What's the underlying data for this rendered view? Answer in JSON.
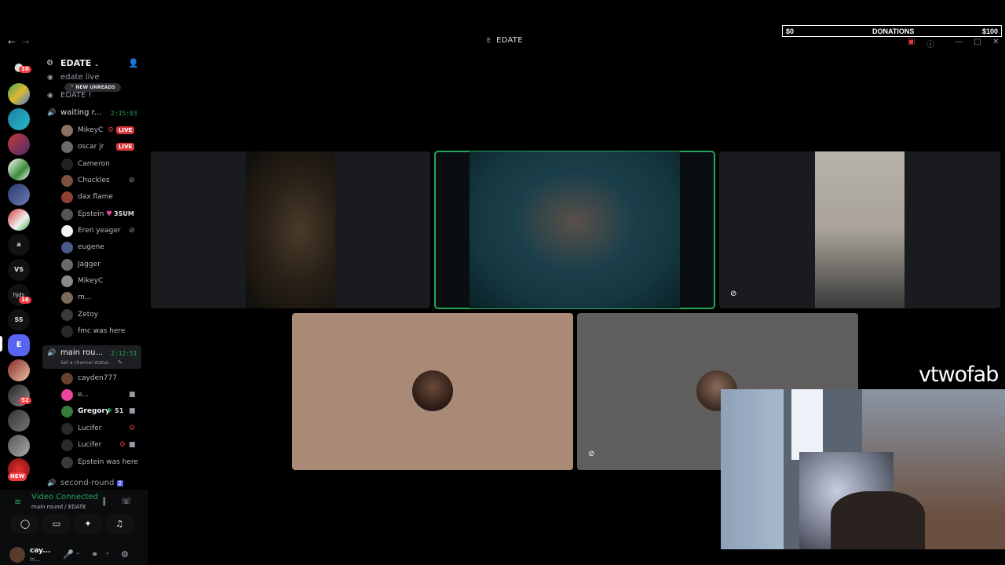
{
  "window": {
    "title": "EDATE",
    "title_icon": "E"
  },
  "donations": {
    "left": "$0",
    "label": "DONATIONS",
    "right": "$100"
  },
  "rail": {
    "home_badge": "10",
    "text_servers": [
      "a",
      "VS",
      "SS"
    ],
    "badge_1": "16",
    "badge_2": "52",
    "active_letter": "E",
    "new_label": "NEW"
  },
  "guild": {
    "name": "EDATE"
  },
  "new_unreads": "NEW UNREADS",
  "channels": {
    "c1": "edate live",
    "c2": "EDATE !",
    "waiting": {
      "name": "waiting r...",
      "time": "2:15:03"
    },
    "main": {
      "name": "main rou...",
      "time": "2:12:51",
      "status": "Set a channel status"
    },
    "second": {
      "name": "second-round",
      "badge": "2"
    }
  },
  "waiting_users": [
    {
      "name": "MikeyC",
      "live": "LIVE"
    },
    {
      "name": "oscar jr",
      "live": "LIVE"
    },
    {
      "name": "Cameron"
    },
    {
      "name": "Chuckles"
    },
    {
      "name": "dax flame"
    },
    {
      "name": "Epstein",
      "tag": "3SUM"
    },
    {
      "name": "Eren yeager"
    },
    {
      "name": "eugene"
    },
    {
      "name": "Jagger"
    },
    {
      "name": "MikeyC"
    },
    {
      "name": "m..."
    },
    {
      "name": "Zetoy"
    },
    {
      "name": "fmc was here"
    }
  ],
  "main_users": [
    {
      "name": "cayden777"
    },
    {
      "name": "e..."
    },
    {
      "name": "Gregory",
      "tag": "S1"
    },
    {
      "name": "Lucifer"
    },
    {
      "name": "Lucifer"
    },
    {
      "name": "Epstein was here"
    }
  ],
  "voice": {
    "status": "Video Connected",
    "location": "main round / EDATE"
  },
  "user_panel": {
    "name": "cay...",
    "status": "In..."
  },
  "overlay": {
    "streamer": "vtwofab"
  },
  "colors": {
    "green": "#23a55a",
    "red": "#da373c",
    "tile_tan": "#a98a76",
    "tile_gray": "#5f5e5c"
  }
}
